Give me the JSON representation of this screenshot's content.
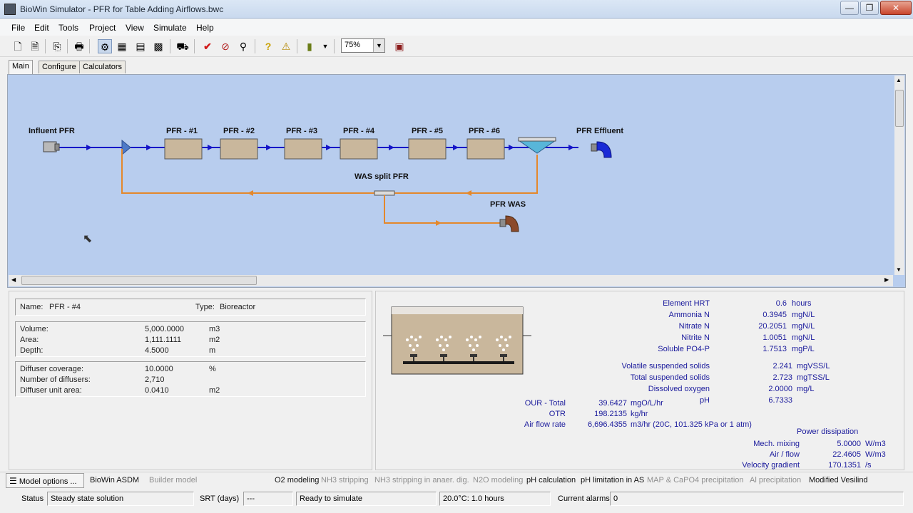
{
  "window": {
    "title": "BioWin Simulator - PFR for Table Adding Airflows.bwc",
    "controls": {
      "minimize": "—",
      "maximize": "❐",
      "close": "✕"
    }
  },
  "menu": [
    "File",
    "Edit",
    "Tools",
    "Project",
    "View",
    "Simulate",
    "Help"
  ],
  "toolbar": {
    "zoom_value": "75%",
    "icons": [
      "new-icon",
      "open-icon",
      "copy-icon",
      "print-icon",
      "elements-icon",
      "table-icon",
      "data-icon",
      "chart-icon",
      "run-icon",
      "check-icon",
      "stop-icon",
      "steady-state-icon",
      "help-icon",
      "alarm-icon",
      "export-icon",
      "dropdown-icon",
      "grid-icon"
    ]
  },
  "tabs": [
    "Main",
    "Configure",
    "Calculators"
  ],
  "diagram": {
    "influent_label": "Influent PFR",
    "reactors": [
      "PFR - #1",
      "PFR - #2",
      "PFR - #3",
      "PFR - #4",
      "PFR - #5",
      "PFR - #6"
    ],
    "effluent_label": "PFR Effluent",
    "split_label": "WAS split PFR",
    "was_label": "PFR WAS",
    "colors": {
      "flow": "#1515c8",
      "recycle": "#e4882b",
      "tank": "#c9b79c"
    }
  },
  "element": {
    "name_label": "Name:",
    "name_value": "PFR - #4",
    "type_label": "Type:",
    "type_value": "Bioreactor",
    "geometry": [
      {
        "label": "Volume:",
        "value": "5,000.0000",
        "unit": "m3"
      },
      {
        "label": "Area:",
        "value": "1,111.1111",
        "unit": "m2"
      },
      {
        "label": "Depth:",
        "value": "4.5000",
        "unit": "m"
      }
    ],
    "diffusers": [
      {
        "label": "Diffuser coverage:",
        "value": "10.0000",
        "unit": "%"
      },
      {
        "label": "Number of diffusers:",
        "value": "2,710",
        "unit": ""
      },
      {
        "label": "Diffuser unit area:",
        "value": "0.0410",
        "unit": "m2"
      }
    ]
  },
  "results": {
    "concentrations": [
      {
        "label": "Element HRT",
        "value": "0.6",
        "unit": "hours"
      },
      {
        "label": "Ammonia N",
        "value": "0.3945",
        "unit": "mgN/L"
      },
      {
        "label": "Nitrate N",
        "value": "20.2051",
        "unit": "mgN/L"
      },
      {
        "label": "Nitrite N",
        "value": "1.0051",
        "unit": "mgN/L"
      },
      {
        "label": "Soluble PO4-P",
        "value": "1.7513",
        "unit": "mgP/L"
      }
    ],
    "solids": [
      {
        "label": "Volatile suspended solids",
        "value": "2.241",
        "unit": "mgVSS/L"
      },
      {
        "label": "Total suspended solids",
        "value": "2.723",
        "unit": "mgTSS/L"
      },
      {
        "label": "Dissolved oxygen",
        "value": "2.0000",
        "unit": "mg/L"
      },
      {
        "label": "pH",
        "value": "6.7333",
        "unit": ""
      }
    ],
    "aeration": [
      {
        "label": "OUR - Total",
        "value": "39.6427",
        "unit": "mgO/L/hr"
      },
      {
        "label": "OTR",
        "value": "198.2135",
        "unit": "kg/hr"
      },
      {
        "label": "Air flow rate",
        "value": "6,696.4355",
        "unit": "m3/hr (20C, 101.325 kPa or 1 atm)"
      }
    ],
    "power_title": "Power dissipation",
    "power": [
      {
        "label": "Mech. mixing",
        "value": "5.0000",
        "unit": "W/m3"
      },
      {
        "label": "Air / flow",
        "value": "22.4605",
        "unit": "W/m3"
      },
      {
        "label": "Velocity gradient",
        "value": "170.1351",
        "unit": "/s"
      }
    ]
  },
  "options": {
    "model_options": "Model options ...",
    "model": "BioWin ASDM",
    "builder": "Builder model",
    "flags": [
      {
        "label": "O2 modeling",
        "active": true
      },
      {
        "label": "NH3 stripping",
        "active": false
      },
      {
        "label": "NH3 stripping in anaer. dig.",
        "active": false
      },
      {
        "label": "N2O modeling",
        "active": false
      },
      {
        "label": "pH calculation",
        "active": true
      },
      {
        "label": "pH limitation in AS",
        "active": true
      },
      {
        "label": "MAP & CaPO4 precipitation",
        "active": false
      },
      {
        "label": "Al precipitation",
        "active": false
      },
      {
        "label": "Modified Vesilind",
        "active": true
      }
    ]
  },
  "status": {
    "status_label": "Status",
    "status_value": "Steady state solution",
    "srt_label": "SRT (days)",
    "srt_value": "---",
    "ready": "Ready to simulate",
    "temp_time": "20.0°C: 1.0 hours",
    "alarms_label": "Current alarms",
    "alarms_value": "0"
  }
}
